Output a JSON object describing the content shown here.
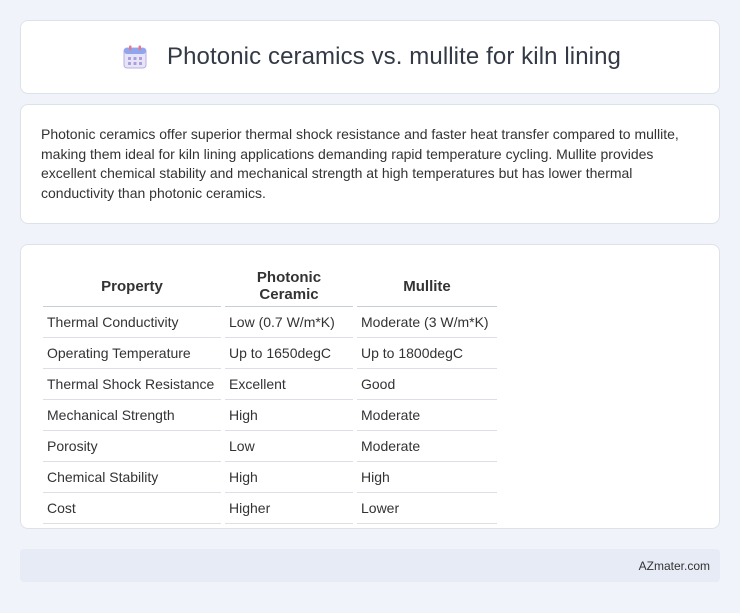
{
  "header": {
    "title": "Photonic ceramics vs. mullite for kiln lining",
    "icon": "calendar-icon"
  },
  "summary": {
    "text": "Photonic ceramics offer superior thermal shock resistance and faster heat transfer compared to mullite, making them ideal for kiln lining applications demanding rapid temperature cycling. Mullite provides excellent chemical stability and mechanical strength at high temperatures but has lower thermal conductivity than photonic ceramics."
  },
  "table": {
    "headers": [
      "Property",
      "Photonic Ceramic",
      "Mullite"
    ],
    "rows": [
      [
        "Thermal Conductivity",
        "Low (0.7 W/m*K)",
        "Moderate (3 W/m*K)"
      ],
      [
        "Operating Temperature",
        "Up to 1650degC",
        "Up to 1800degC"
      ],
      [
        "Thermal Shock Resistance",
        "Excellent",
        "Good"
      ],
      [
        "Mechanical Strength",
        "High",
        "Moderate"
      ],
      [
        "Porosity",
        "Low",
        "Moderate"
      ],
      [
        "Chemical Stability",
        "High",
        "High"
      ],
      [
        "Cost",
        "Higher",
        "Lower"
      ]
    ]
  },
  "footer": {
    "brand": "AZmater.com"
  }
}
